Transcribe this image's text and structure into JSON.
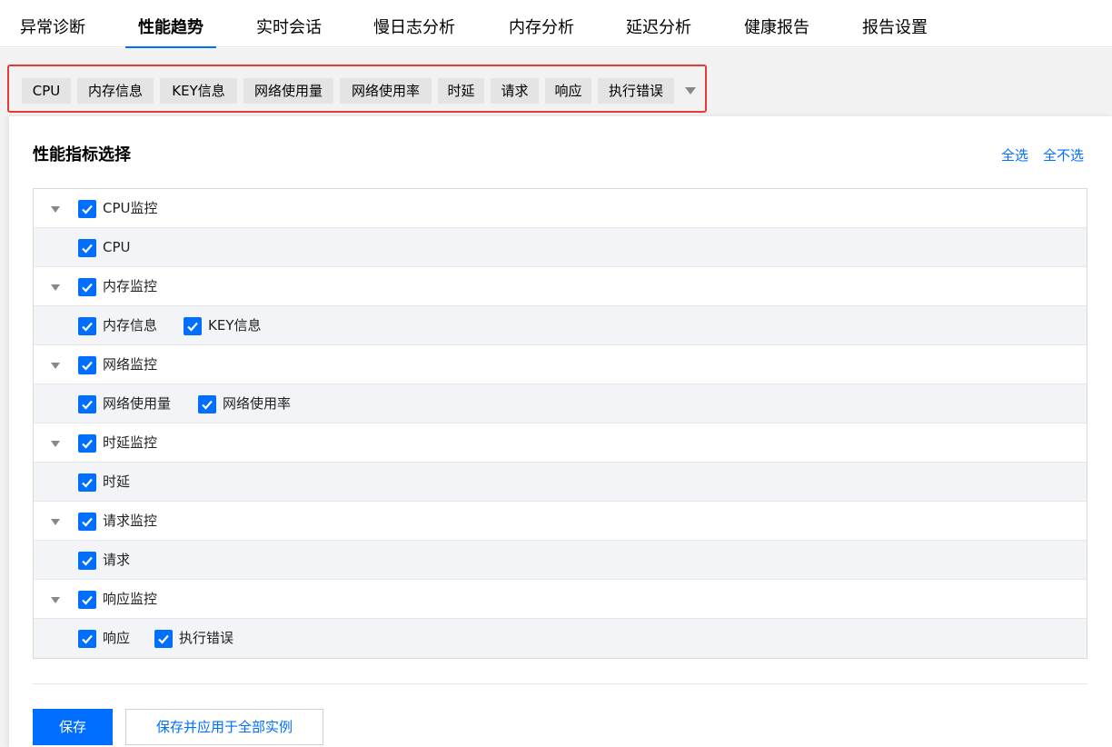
{
  "top_tabs": [
    "异常诊断",
    "性能趋势",
    "实时会话",
    "慢日志分析",
    "内存分析",
    "延迟分析",
    "健康报告",
    "报告设置"
  ],
  "active_tab": "性能趋势",
  "chips": [
    "CPU",
    "内存信息",
    "KEY信息",
    "网络使用量",
    "网络使用率",
    "时延",
    "请求",
    "响应",
    "执行错误"
  ],
  "panel": {
    "title": "性能指标选择",
    "select_all": "全选",
    "deselect_all": "全不选"
  },
  "groups": [
    {
      "label": "CPU监控",
      "checked": true,
      "items": [
        {
          "label": "CPU",
          "checked": true
        }
      ]
    },
    {
      "label": "内存监控",
      "checked": true,
      "items": [
        {
          "label": "内存信息",
          "checked": true
        },
        {
          "label": "KEY信息",
          "checked": true
        }
      ]
    },
    {
      "label": "网络监控",
      "checked": true,
      "items": [
        {
          "label": "网络使用量",
          "checked": true
        },
        {
          "label": "网络使用率",
          "checked": true
        }
      ]
    },
    {
      "label": "时延监控",
      "checked": true,
      "items": [
        {
          "label": "时延",
          "checked": true
        }
      ]
    },
    {
      "label": "请求监控",
      "checked": true,
      "items": [
        {
          "label": "请求",
          "checked": true
        }
      ]
    },
    {
      "label": "响应监控",
      "checked": true,
      "items": [
        {
          "label": "响应",
          "checked": true
        },
        {
          "label": "执行错误",
          "checked": true
        }
      ]
    }
  ],
  "buttons": {
    "save": "保存",
    "save_apply_all": "保存并应用于全部实例"
  },
  "colors": {
    "accent": "#006eff",
    "highlight_border": "#e63a3a"
  }
}
